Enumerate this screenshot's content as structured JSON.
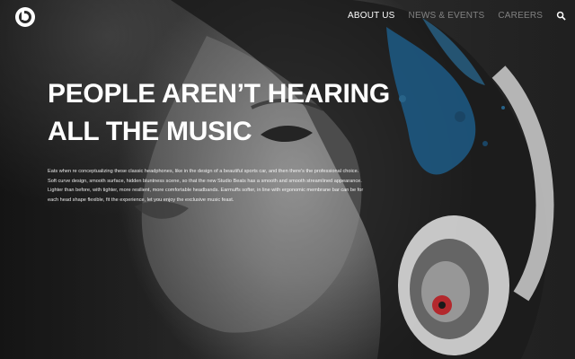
{
  "brand": {
    "logo_letter": "b",
    "logo_color": "#ffffff"
  },
  "nav": {
    "items": [
      {
        "label": "ABOUT US",
        "active": true
      },
      {
        "label": "NEWS & EVENTS",
        "active": false
      },
      {
        "label": "CAREERS",
        "active": false
      }
    ],
    "search_icon": "search-icon",
    "menu_icon": "hamburger-menu-icon"
  },
  "hero": {
    "headline_line1": "PEOPLE AREN’T HEARING",
    "headline_line2": "ALL THE MUSIC",
    "description": "Eats when re conceptualizing these classic headphones, like in the design of a beautiful sports car, and then there's the professional choice. Soft curve design, smooth surface, hidden bluntness scene, so that the new Studio Beats has a smooth and smooth streamlined appearance. Lighter than before, with tighter, more resilient, more comfortable headbands. Earmuffs softer, in line with ergonomic membrane bar can be for each head shape flexible, fit the experience, let you enjoy the exclusive music feast."
  },
  "colors": {
    "text": "#ffffff",
    "nav_inactive": "#8f8f8f",
    "accent_blue": "#1d5b86",
    "accent_red": "#b3282d",
    "background": "#2b2b2b"
  }
}
